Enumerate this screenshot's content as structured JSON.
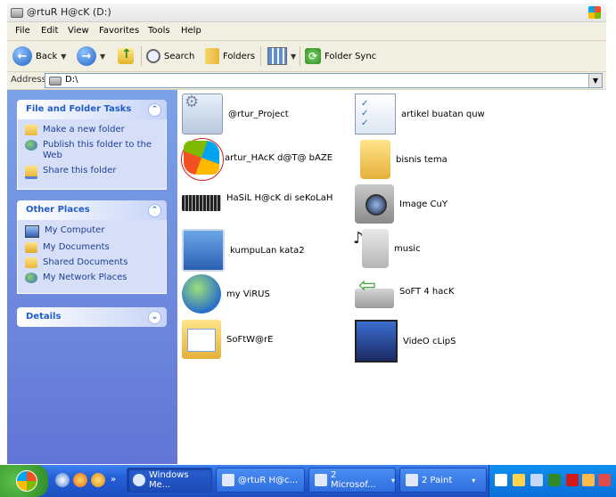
{
  "window": {
    "title": "@rtuR H@cK (D:)"
  },
  "menubar": {
    "items": [
      "File",
      "Edit",
      "View",
      "Favorites",
      "Tools",
      "Help"
    ]
  },
  "toolbar": {
    "back_label": "Back",
    "search_label": "Search",
    "folders_label": "Folders",
    "sync_label": "Folder Sync"
  },
  "address": {
    "label": "Address",
    "value": "D:\\"
  },
  "tasks_panel": {
    "title": "File and Folder Tasks",
    "items": [
      {
        "label": "Make a new folder",
        "icon": "new-folder-icon"
      },
      {
        "label": "Publish this folder to the Web",
        "icon": "publish-web-icon"
      },
      {
        "label": "Share this folder",
        "icon": "share-folder-icon"
      }
    ]
  },
  "places_panel": {
    "title": "Other Places",
    "items": [
      {
        "label": "My Computer",
        "icon": "my-computer-icon"
      },
      {
        "label": "My Documents",
        "icon": "my-documents-icon"
      },
      {
        "label": "Shared Documents",
        "icon": "shared-documents-icon"
      },
      {
        "label": "My Network Places",
        "icon": "network-places-icon"
      }
    ]
  },
  "details_panel": {
    "title": "Details"
  },
  "files": [
    {
      "name": "@rtur_Project",
      "icon": "project-folder-icon"
    },
    {
      "name": "artikel buatan quw",
      "icon": "checklist-icon"
    },
    {
      "name": "artur_HAcK d@T@ bAZE",
      "icon": "windows-logo-icon"
    },
    {
      "name": "bisnis  tema",
      "icon": "folder-icon"
    },
    {
      "name": "HaSiL H@cK di seKoLaH",
      "icon": "chip-icon"
    },
    {
      "name": "Image CuY",
      "icon": "camera-icon"
    },
    {
      "name": "kumpuLan kata2",
      "icon": "slideshow-icon"
    },
    {
      "name": "music",
      "icon": "music-icon"
    },
    {
      "name": "my ViRUS",
      "icon": "globe-icon"
    },
    {
      "name": "SoFT 4 hacK",
      "icon": "software-icon"
    },
    {
      "name": "SoFtW@rE",
      "icon": "software-folder-icon"
    },
    {
      "name": "VideO cLipS",
      "icon": "video-icon"
    }
  ],
  "taskbar": {
    "buttons": [
      {
        "label": "Windows Me..."
      },
      {
        "label": "@rtuR H@c..."
      },
      {
        "label": "2 Microsof..."
      },
      {
        "label": "2 Paint"
      }
    ]
  }
}
